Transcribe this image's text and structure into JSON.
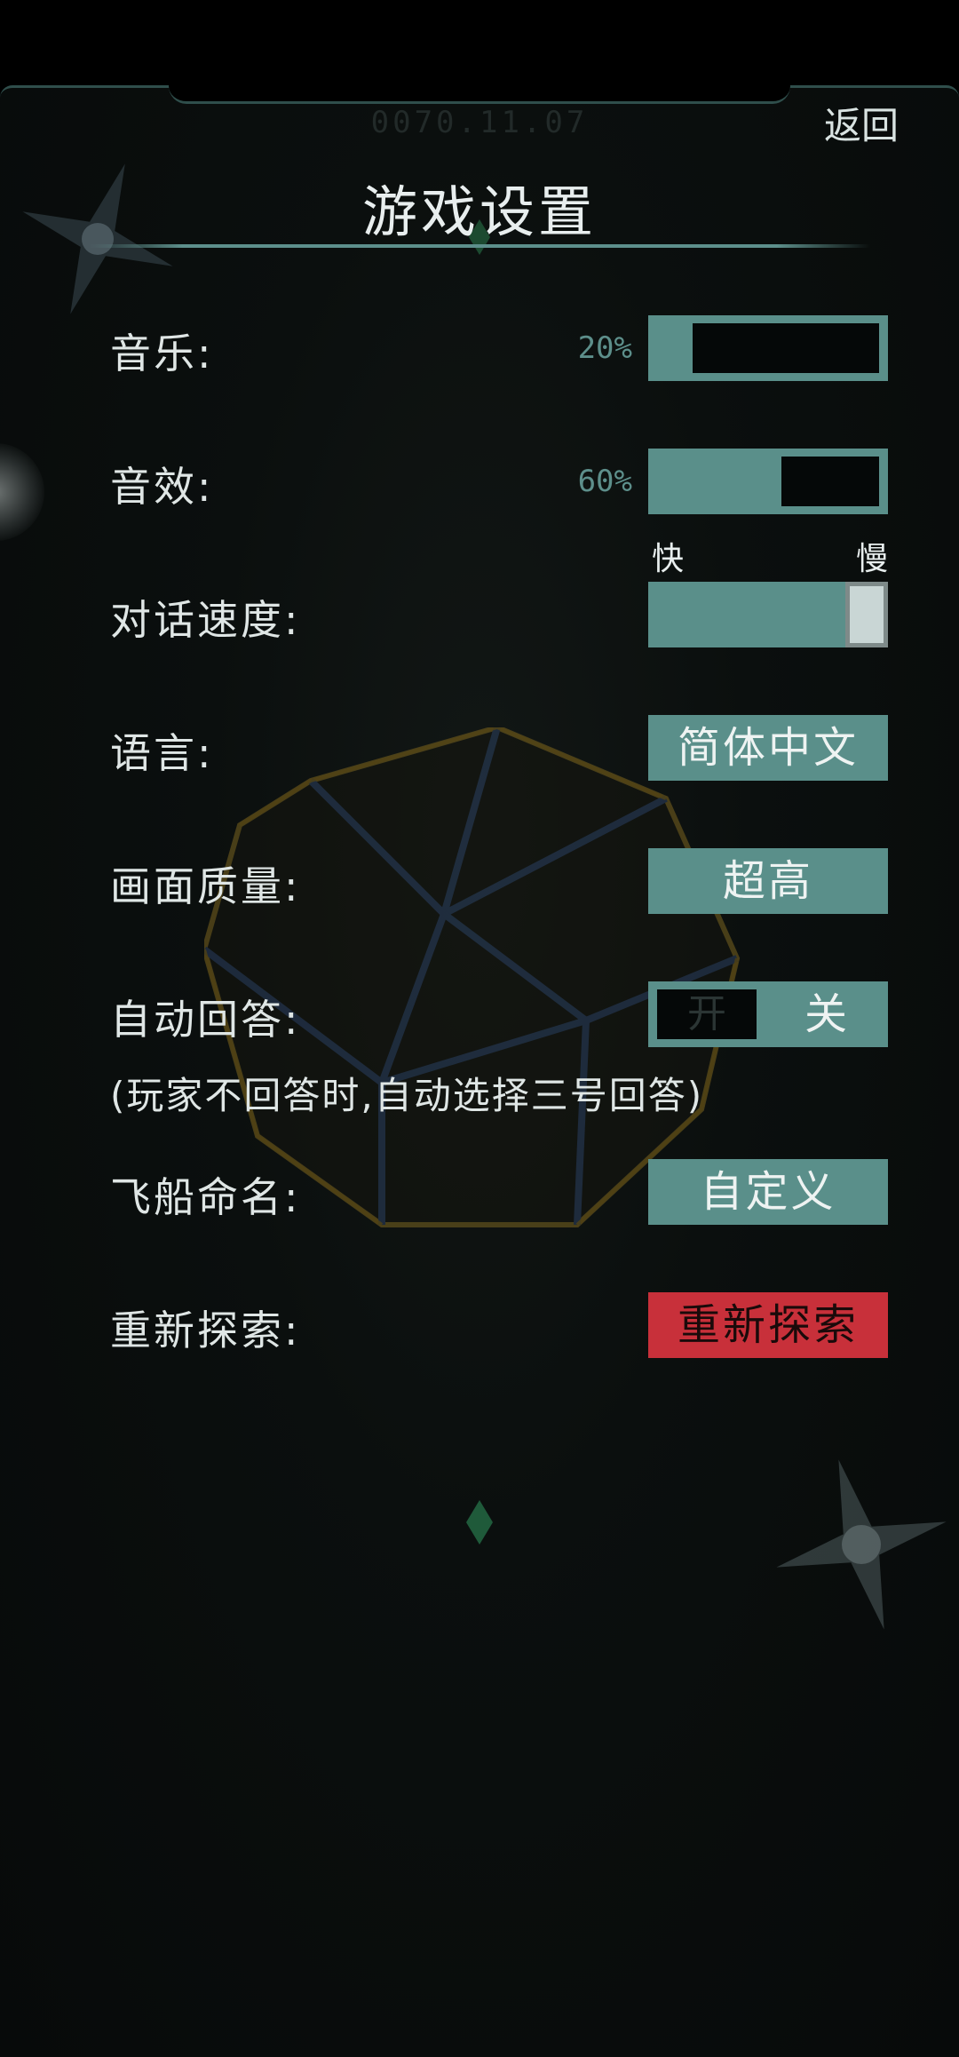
{
  "header": {
    "date": "0070.11.07",
    "back_label": "返回",
    "title": "游戏设置"
  },
  "settings": {
    "music": {
      "label": "音乐:",
      "percent_text": "20%",
      "level": 0.2
    },
    "sfx": {
      "label": "音效:",
      "percent_text": "60%",
      "level": 0.6
    },
    "dialog_speed": {
      "label": "对话速度:",
      "fast_label": "快",
      "slow_label": "慢",
      "level": 1.0
    },
    "language": {
      "label": "语言:",
      "value": "简体中文"
    },
    "graphics": {
      "label": "画面质量:",
      "value": "超高"
    },
    "auto_answer": {
      "label": "自动回答:",
      "on_label": "开",
      "off_label": "关",
      "selected": "关",
      "note": "(玩家不回答时,自动选择三号回答)"
    },
    "ship_name": {
      "label": "飞船命名:",
      "value": "自定义"
    },
    "reexplore": {
      "label": "重新探索:",
      "button_label": "重新探索"
    }
  },
  "colors": {
    "accent": "#5a8f8a",
    "danger": "#c8303a",
    "text": "#dfe6e5"
  }
}
